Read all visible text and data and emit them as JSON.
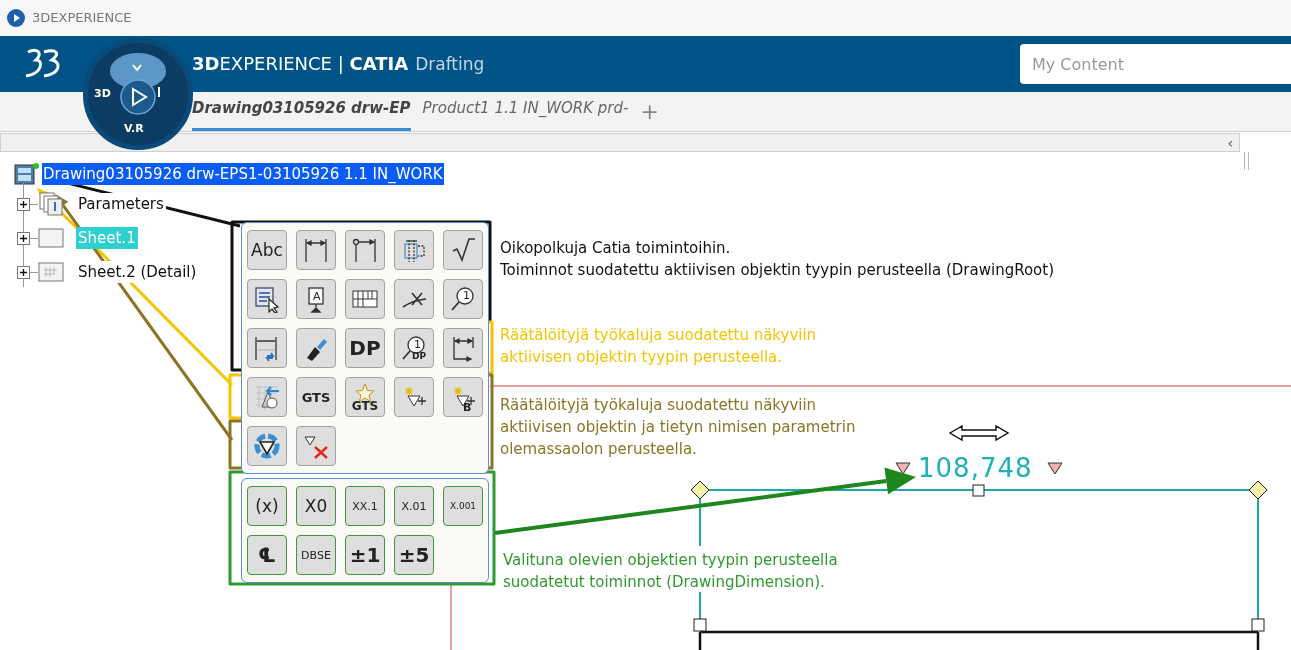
{
  "window": {
    "title": "3DEXPERIENCE"
  },
  "header": {
    "compass_labels": [
      "3D",
      "V.R"
    ],
    "title": "**3D**EXPERIENCE | **CATIA**",
    "app": "Drafting",
    "search": {
      "placeholder": "My Content"
    }
  },
  "tabs": [
    {
      "label": "Drawing03105926 drw-EP",
      "selected": true
    },
    {
      "label": "Product1 1.1 IN_WORK prd-",
      "selected": false
    }
  ],
  "new_tab": "+",
  "toolbar": {
    "collapse": "‹"
  },
  "tree": {
    "label": "Drawing03105926 drw-EPS1-03105926 1.1 IN_WORK",
    "selected": true,
    "children": [
      {
        "label": "Parameters",
        "kind": "parameters",
        "selected": false
      },
      {
        "label": "Sheet.1",
        "kind": "sheet",
        "selected": true
      },
      {
        "label": "Sheet.2 (Detail)",
        "kind": "detail-sheet",
        "selected": false
      }
    ]
  },
  "palette": {
    "sections": [
      {
        "color": "#a3a3a3",
        "rows": [
          [
            {
              "kind": "text",
              "label": "Abc"
            },
            {
              "kind": "dimension"
            },
            {
              "kind": "dimension-origin"
            },
            {
              "kind": "table-dimension"
            },
            {
              "kind": "check"
            }
          ],
          [
            {
              "kind": "list-cursor"
            },
            {
              "kind": "text-board",
              "label": "A"
            },
            {
              "kind": "table"
            },
            {
              "kind": "weld"
            },
            {
              "kind": "balloon",
              "label": "1"
            }
          ],
          [
            {
              "kind": "dimension-link"
            },
            {
              "kind": "paintbrush"
            },
            {
              "kind": "strong",
              "label": "DP"
            },
            {
              "kind": "balloon",
              "label": "1",
              "sublabel": "DP"
            },
            {
              "kind": "corner-dimension"
            }
          ],
          [
            {
              "kind": "grid-shapes"
            },
            {
              "kind": "strong",
              "label": "GTS"
            },
            {
              "kind": "star",
              "label": "GTS"
            },
            {
              "kind": "datum-plus"
            },
            {
              "kind": "datum-plus",
              "label": "B"
            }
          ],
          [
            {
              "kind": "datum-cycle"
            },
            {
              "kind": "datum-delete"
            }
          ]
        ]
      },
      {
        "color": "#3c9a3c",
        "rows": [
          [
            {
              "kind": "text",
              "label": "(x)"
            },
            {
              "kind": "text",
              "label": "X0"
            },
            {
              "kind": "text",
              "label": "XX.1"
            },
            {
              "kind": "text",
              "label": "X.01"
            },
            {
              "kind": "text",
              "label": "X.001"
            }
          ],
          [
            {
              "kind": "strong",
              "label": "℄"
            },
            {
              "kind": "text",
              "label": "DBSE"
            },
            {
              "kind": "strong",
              "label": "±1"
            },
            {
              "kind": "strong",
              "label": "±5"
            }
          ]
        ]
      }
    ]
  },
  "callouts": [
    {
      "color": "#111111",
      "lines": [
        "Oikopolkuja Catia toimintoihin.",
        "Toiminnot suodatettu aktiivisen objektin tyypin perusteella (DrawingRoot)"
      ]
    },
    {
      "color": "#f5c400",
      "lines": [
        "Räätälöityjä työkaluja suodatettu näkyviin",
        "aktiivisen objektin tyypin perusteella."
      ]
    },
    {
      "color": "#8c7424",
      "lines": [
        "Räätälöityjä työkaluja suodatettu näkyviin",
        "aktiivisen objektin ja tietyn nimisen parametrin",
        "olemassaolon perusteella."
      ]
    },
    {
      "color": "#2f9a2f",
      "lines": [
        "Valituna olevien objektien tyypin perusteella",
        "suodatetut toiminnot (DrawingDimension)."
      ]
    }
  ],
  "dimension": {
    "value": "108,748"
  }
}
